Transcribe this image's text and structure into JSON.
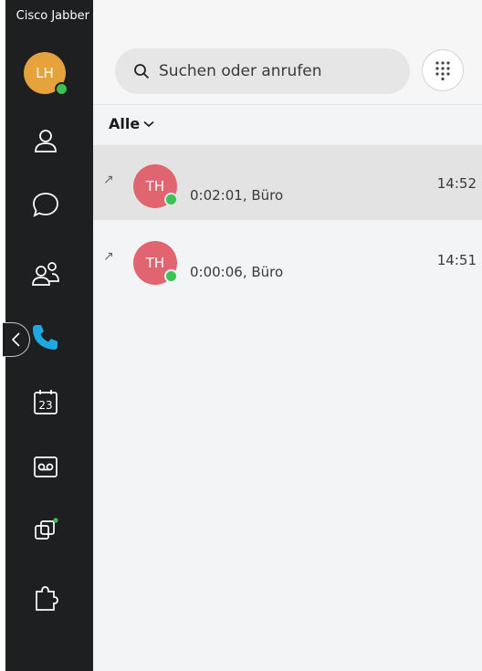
{
  "app": {
    "title": "Cisco Jabber"
  },
  "user": {
    "initials": "LH",
    "presence_color": "#3cc155",
    "avatar_color": "#e6a23c"
  },
  "nav": [
    {
      "name": "contacts-icon",
      "active": false
    },
    {
      "name": "chat-icon",
      "active": false
    },
    {
      "name": "meetings-people-icon",
      "active": false
    },
    {
      "name": "phone-icon",
      "active": true
    },
    {
      "name": "calendar-icon",
      "label": "23",
      "active": false
    },
    {
      "name": "voicemail-icon",
      "active": false
    },
    {
      "name": "screen-share-icon",
      "active": false
    },
    {
      "name": "plugin-icon",
      "active": false
    }
  ],
  "search": {
    "placeholder": "Suchen oder anrufen"
  },
  "filter": {
    "label": "Alle"
  },
  "calls": [
    {
      "initials": "TH",
      "detail": "0:02:01, Büro",
      "time": "14:52",
      "direction_icon": "outgoing-call-icon",
      "selected": true
    },
    {
      "initials": "TH",
      "detail": "0:00:06, Büro",
      "time": "14:51",
      "direction_icon": "outgoing-call-icon",
      "selected": false
    }
  ],
  "colors": {
    "sidebar": "#1d1f21",
    "accent_phone": "#1ea7e1",
    "avatar_th": "#e06570"
  }
}
